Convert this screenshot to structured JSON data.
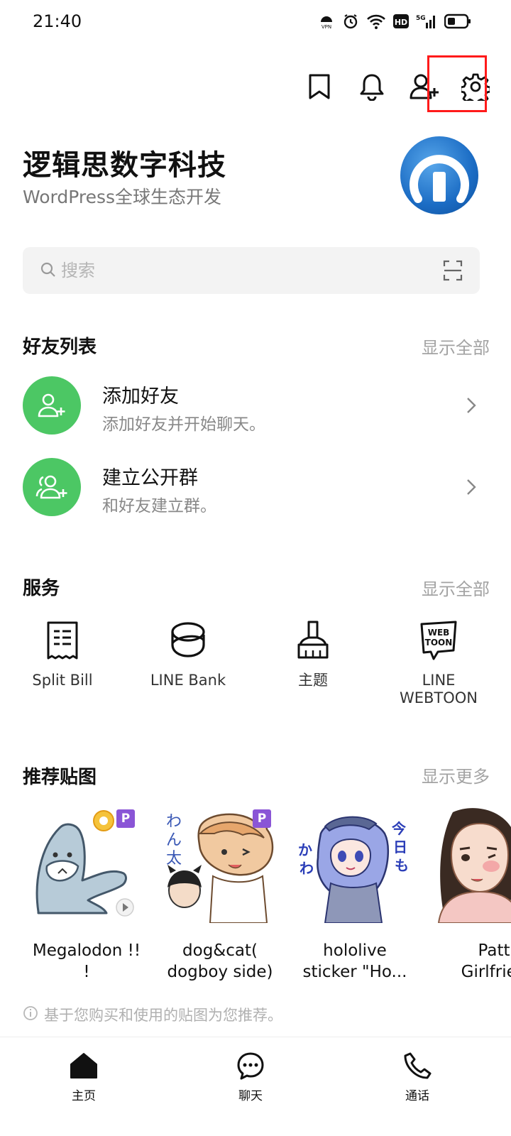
{
  "status_bar": {
    "time": "21:40",
    "vpn": "VPN",
    "hd": "HD",
    "network": "5G"
  },
  "top_actions": [
    "bookmark-icon",
    "bell-icon",
    "add-friend-icon",
    "gear-icon"
  ],
  "profile": {
    "name": "逻辑思数字科技",
    "status": "WordPress全球生态开发"
  },
  "search": {
    "placeholder": "搜索"
  },
  "friends": {
    "title": "好友列表",
    "more": "显示全部",
    "items": [
      {
        "title": "添加好友",
        "subtitle": "添加好友并开始聊天。"
      },
      {
        "title": "建立公开群",
        "subtitle": "和好友建立群。"
      }
    ]
  },
  "services": {
    "title": "服务",
    "more": "显示全部",
    "items": [
      {
        "label": "Split Bill",
        "icon": "receipt-icon"
      },
      {
        "label": "LINE Bank",
        "icon": "bank-icon"
      },
      {
        "label": "主题",
        "icon": "brush-icon"
      },
      {
        "label": "LINE\nWEBTOON",
        "icon": "webtoon-icon"
      }
    ]
  },
  "stickers": {
    "title": "推荐贴图",
    "more": "显示更多",
    "items": [
      {
        "name": "Megalodon !!\n!",
        "badge": "P"
      },
      {
        "name": "dog&cat(\ndogboy side)",
        "badge": "P"
      },
      {
        "name": "hololive\nsticker \"Ho...",
        "badge": ""
      },
      {
        "name": "Patt\nGirlfrien",
        "badge": ""
      }
    ],
    "note": "基于您购买和使用的贴图为您推荐。"
  },
  "bottom_nav": [
    {
      "label": "主页",
      "icon": "home-icon"
    },
    {
      "label": "聊天",
      "icon": "chat-icon"
    },
    {
      "label": "通话",
      "icon": "phone-icon"
    }
  ],
  "colors": {
    "accent": "#4cc764",
    "highlight": "#ff1a1a",
    "premium": "#8a55d6"
  }
}
